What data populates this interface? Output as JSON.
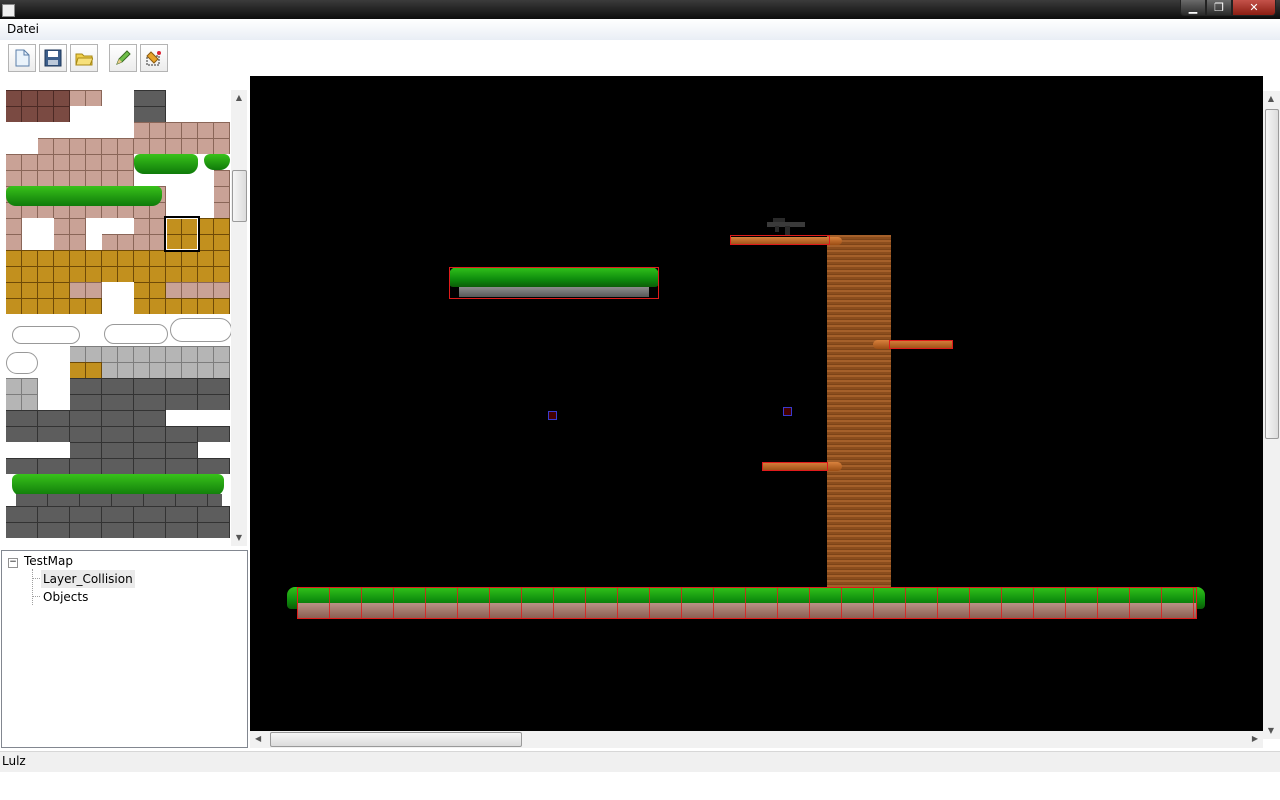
{
  "window": {
    "title": ""
  },
  "menu": {
    "items": [
      "Datei"
    ]
  },
  "toolbar": {
    "buttons": [
      "new-icon",
      "save-icon",
      "open-icon",
      "pencil-icon",
      "eraser-icon"
    ]
  },
  "tree": {
    "root": "TestMap",
    "toggle": "−",
    "children": [
      "Layer_Collision",
      "Objects"
    ],
    "selected": "Layer_Collision"
  },
  "status": {
    "text": "Lulz"
  },
  "colors": {
    "canvas_bg": "#000000",
    "collision": "#e01b1b",
    "object_marker": "#3a3acd",
    "grass": "#1fa811"
  }
}
